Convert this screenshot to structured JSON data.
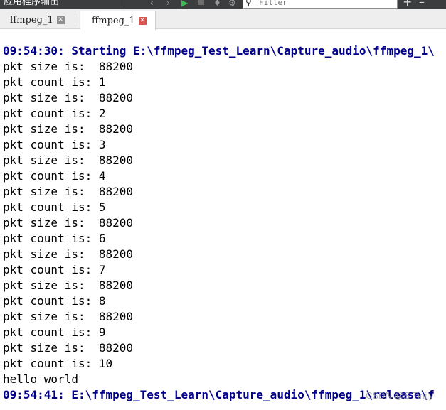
{
  "toolbar": {
    "title": "应用程序输出",
    "filter_placeholder": "Filter",
    "icons": [
      "chevron-left-icon",
      "chevron-right-icon",
      "play-icon",
      "stop-icon",
      "gear-icon",
      "search-icon",
      "plus-icon",
      "minus-icon"
    ],
    "colors": {
      "background": "#3c3d3f",
      "play": "#3fb950"
    }
  },
  "tabs": [
    {
      "label": "ffmpeg_1",
      "active": false
    },
    {
      "label": "ffmpeg_1",
      "active": true
    }
  ],
  "output": {
    "start_line": "09:54:30: Starting E:\\ffmpeg_Test_Learn\\Capture_audio\\ffmpeg_1\\",
    "lines": [
      "pkt size is:  88200",
      "pkt count is: 1",
      "pkt size is:  88200",
      "pkt count is: 2",
      "pkt size is:  88200",
      "pkt count is: 3",
      "pkt size is:  88200",
      "pkt count is: 4",
      "pkt size is:  88200",
      "pkt count is: 5",
      "pkt size is:  88200",
      "pkt count is: 6",
      "pkt size is:  88200",
      "pkt count is: 7",
      "pkt size is:  88200",
      "pkt count is: 8",
      "pkt size is:  88200",
      "pkt count is: 9",
      "pkt size is:  88200",
      "pkt count is: 10",
      "hello world"
    ],
    "end_line": "09:54:41: E:\\ffmpeg_Test_Learn\\Capture_audio\\ffmpeg_1\\release\\f",
    "colors": {
      "header_text": "#00008b",
      "body_text": "#000000"
    }
  },
  "watermark": "CSDN @S Tinily"
}
